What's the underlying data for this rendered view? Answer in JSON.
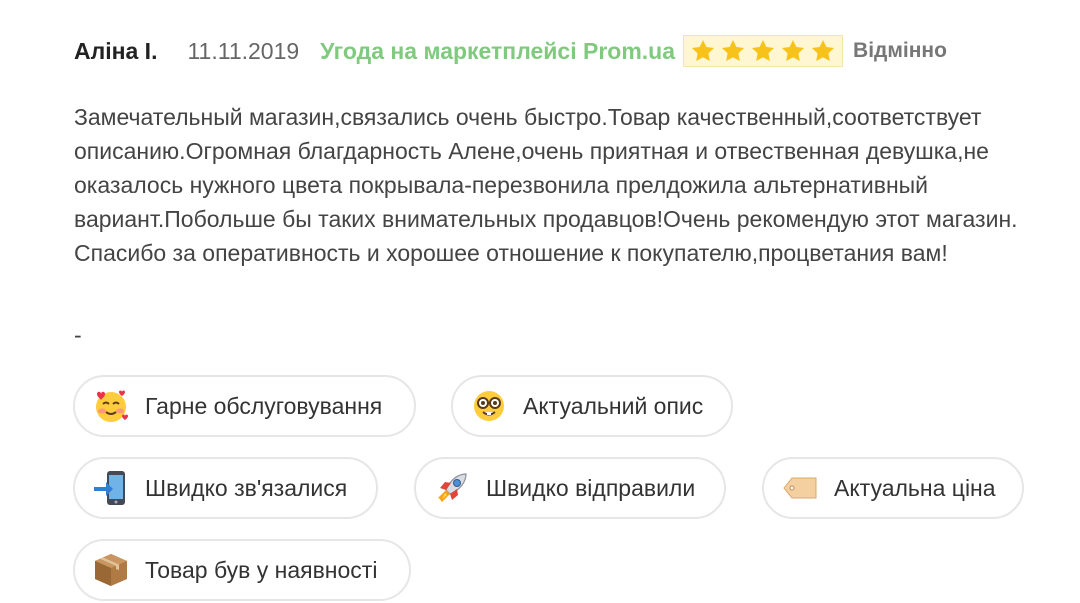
{
  "review": {
    "author": "Аліна І.",
    "date": "11.11.2019",
    "deal_label": "Угода на маркетплейсі Prom.ua",
    "rating": 5,
    "rating_max": 5,
    "rating_label": "Відмінно",
    "paragraph_1": "Замечательный магазин,связались очень быстро.Товар качественный,соответствует описанию.Огромная благдарность Алене,очень приятная и отвественная девушка,не оказалось нужного цвета покрывала-перезвонила прелдожила альтернативный вариант.Побольше бы таких внимательных продавцов!Очень рекомендую этот магазин.",
    "paragraph_2": "Спасибо за оперативность и хорошее отношение к покупателю,процветания вам!",
    "separator": "-"
  },
  "tags": [
    {
      "label": "Гарне обслуговування",
      "icon": "smiling-face-with-hearts-icon"
    },
    {
      "label": "Актуальний опис",
      "icon": "nerd-face-icon"
    },
    {
      "label": "Швидко зв'язалися",
      "icon": "mobile-phone-arrow-icon"
    },
    {
      "label": "Швидко відправили",
      "icon": "rocket-icon"
    },
    {
      "label": "Актуальна ціна",
      "icon": "price-tag-icon"
    },
    {
      "label": "Товар був у наявності",
      "icon": "package-icon"
    }
  ],
  "colors": {
    "deal_green": "#7fca7f",
    "star_gold": "#f7c21a",
    "rating_bg": "#fff7d1",
    "tag_border": "#e6e6e6"
  }
}
